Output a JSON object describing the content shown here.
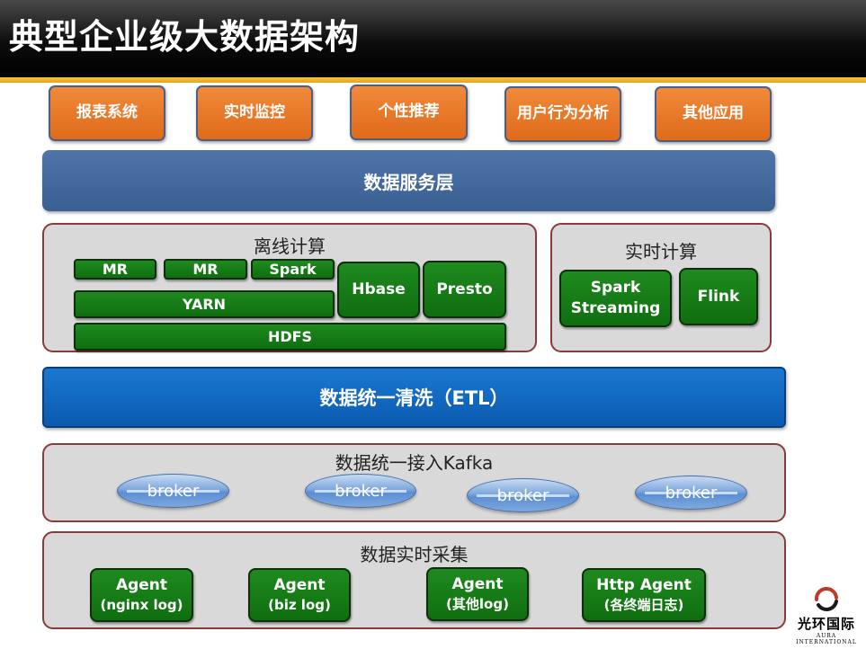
{
  "title": "典型企业级大数据架构",
  "applications": [
    "报表系统",
    "实时监控",
    "个性推荐",
    "用户行为分析",
    "其他应用"
  ],
  "service_layer": "数据服务层",
  "offline": {
    "title": "离线计算",
    "mr1": "MR",
    "mr2": "MR",
    "spark": "Spark",
    "yarn": "YARN",
    "hbase": "Hbase",
    "presto": "Presto",
    "hdfs": "HDFS"
  },
  "realtime": {
    "title": "实时计算",
    "spark_streaming_1": "Spark",
    "spark_streaming_2": "Streaming",
    "flink": "Flink"
  },
  "etl": "数据统一清洗（ETL）",
  "kafka": {
    "title": "数据统一接入Kafka",
    "brokers": [
      "broker",
      "broker",
      "broker",
      "broker"
    ]
  },
  "collection": {
    "title": "数据实时采集",
    "agents": [
      {
        "name": "Agent",
        "detail": "(nginx log)"
      },
      {
        "name": "Agent",
        "detail": "(biz log)"
      },
      {
        "name": "Agent",
        "detail": "(其他log)"
      },
      {
        "name": "Http Agent",
        "detail": "(各终端日志)"
      }
    ]
  },
  "logo": {
    "cn": "光环国际",
    "en": "AURA INTERNATIONAL",
    "accent": "#c0392b"
  },
  "colors": {
    "app_orange": "#e8731f",
    "service_blue": "#3f6497",
    "etl_blue": "#0f66c0",
    "component_green": "#137a13",
    "panel_gray": "#d9d9d9",
    "panel_border": "#8b3a3a",
    "title_accent": "#f0b42c"
  }
}
